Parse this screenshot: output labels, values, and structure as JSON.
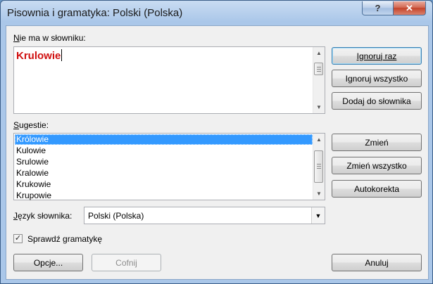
{
  "window": {
    "title": "Pisownia i gramatyka: Polski (Polska)",
    "help_label": "?",
    "close_label": "✕"
  },
  "not_in_dictionary": {
    "label_u": "N",
    "label_rest": "ie ma w słowniku:",
    "word": "Krulowie"
  },
  "suggestions": {
    "label_u": "S",
    "label_rest": "ugestie:",
    "items": [
      "Królowie",
      "Kulowie",
      "Srulowie",
      "Kralowie",
      "Krukowie",
      "Krupowie"
    ],
    "selected_index": 0
  },
  "buttons": {
    "ignore_once": "Ignoruj raz",
    "ignore_all": "Ignoruj wszystko",
    "add_to_dictionary": "Dodaj do słownika",
    "change": "Zmień",
    "change_all": "Zmień wszystko",
    "autocorrect": "Autokorekta",
    "options": "Opcje...",
    "undo": "Cofnij",
    "cancel": "Anuluj"
  },
  "dictionary_language": {
    "label_u": "J",
    "label_rest": "ęzyk słownika:",
    "value": "Polski (Polska)"
  },
  "check_grammar": {
    "label": "Sprawdź gramatykę",
    "checked": true,
    "check_glyph": "✓"
  },
  "icons": {
    "scroll_up": "▲",
    "scroll_down": "▼",
    "dropdown": "▼"
  }
}
